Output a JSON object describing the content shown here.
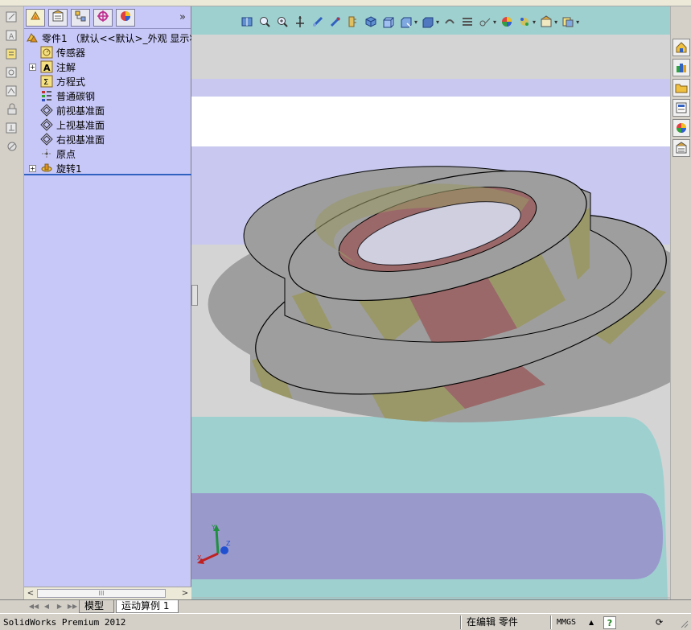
{
  "fm_tabs": [
    {
      "icon": "feature-manager-icon"
    },
    {
      "icon": "property-manager-icon"
    },
    {
      "icon": "configuration-manager-icon"
    },
    {
      "icon": "dimxpert-icon"
    },
    {
      "icon": "display-manager-icon"
    }
  ],
  "fm_more": "»",
  "tree": {
    "root": {
      "label": "零件1 （默认<<默认>_外观 显示状",
      "icon": "part-icon"
    },
    "items": [
      {
        "label": "传感器",
        "icon": "sensor-icon",
        "expandable": false
      },
      {
        "label": "注解",
        "icon": "annotations-icon",
        "expandable": true
      },
      {
        "label": "方程式",
        "icon": "equations-icon",
        "expandable": false
      },
      {
        "label": "普通碳钢",
        "icon": "material-icon",
        "expandable": false
      },
      {
        "label": "前视基准面",
        "icon": "plane-icon",
        "expandable": false
      },
      {
        "label": "上视基准面",
        "icon": "plane-icon",
        "expandable": false
      },
      {
        "label": "右视基准面",
        "icon": "plane-icon",
        "expandable": false
      },
      {
        "label": "原点",
        "icon": "origin-icon",
        "expandable": false
      },
      {
        "label": "旋转1",
        "icon": "revolve-icon",
        "expandable": true
      }
    ]
  },
  "fm_scroll": {
    "left": "<",
    "right": ">",
    "thumb": "III"
  },
  "heads_up_toolbar": [
    "view-orientation-icon",
    "zoom-to-fit-icon",
    "zoom-to-area-icon",
    "previous-view-icon",
    "section-view-icon",
    "dynamic-annotation-icon",
    "ruler-icon",
    "view-cube-icon",
    "display-style-icon",
    "hide-show-icon",
    "apply-scene-icon",
    "appearance-icon",
    "view-settings-icon",
    "screen-capture-icon",
    "render-tools-icon"
  ],
  "task_pane": [
    "home-icon",
    "design-library-icon",
    "file-explorer-icon",
    "view-palette-icon",
    "appearances-icon",
    "custom-properties-icon"
  ],
  "bottom_tabs": {
    "model": "模型",
    "motion": "运动算例 1"
  },
  "status": {
    "app": "SolidWorks Premium 2012",
    "mode": "在编辑 零件",
    "units": "MMGS",
    "units_arrow": "▲",
    "help": "?",
    "rebuild": "⟳"
  },
  "colors": {
    "panel_bg": "#c8c8f8",
    "model_grey": "#9e9e9e",
    "model_yellow": "#9a9868",
    "model_red": "#9a6868",
    "viewport_band_cyan": "#9ed0d0",
    "viewport_band_purple": "#9999cc"
  }
}
